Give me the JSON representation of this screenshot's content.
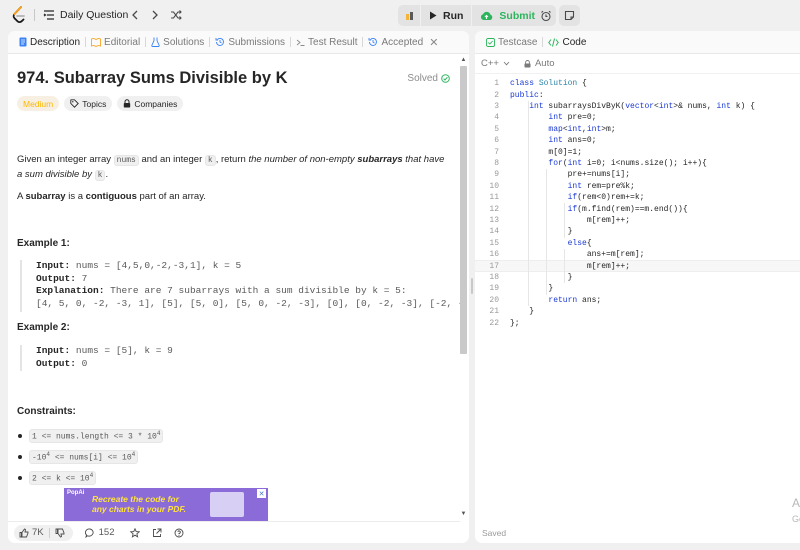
{
  "topbar": {
    "title": "Daily Question",
    "run_label": "Run",
    "submit_label": "Submit"
  },
  "tabs": {
    "description": "Description",
    "editorial": "Editorial",
    "solutions": "Solutions",
    "submissions": "Submissions",
    "test_result": "Test Result",
    "accepted": "Accepted"
  },
  "problem": {
    "title": "974. Subarray Sums Divisible by K",
    "status": "Solved",
    "difficulty": "Medium",
    "topics_label": "Topics",
    "companies_label": "Companies",
    "description": {
      "p1_a": "Given an integer array",
      "p1_code1": "nums",
      "p1_b": "and an integer",
      "p1_code2": "k",
      "p1_c": ", return",
      "p1_d": "the number of non-empty",
      "p1_e": "subarrays",
      "p1_f": "that have a sum divisible by",
      "p1_code3": "k",
      "p1_g": ".",
      "p2_a": "A",
      "p2_b": "subarray",
      "p2_c": "is a",
      "p2_d": "contiguous",
      "p2_e": "part of an array."
    },
    "examples": [
      {
        "title": "Example 1:",
        "input_label": "Input:",
        "input": "nums = [4,5,0,-2,-3,1], k = 5",
        "output_label": "Output:",
        "output": "7",
        "explanation_label": "Explanation:",
        "explanation": "There are 7 subarrays with a sum divisible by k = 5:",
        "explanation_detail": "[4, 5, 0, -2, -3, 1], [5], [5, 0], [5, 0, -2, -3], [0], [0, -2, -3], [-2, -3"
      },
      {
        "title": "Example 2:",
        "input_label": "Input:",
        "input": "nums = [5], k = 9",
        "output_label": "Output:",
        "output": "0"
      }
    ],
    "constraints_title": "Constraints:",
    "constraints": [
      {
        "a": "1 <= nums.length <= 3 * 10",
        "sup": "4",
        "b": ""
      },
      {
        "a": "-10",
        "sup": "4",
        "b": " <= nums[i] <= 10",
        "sup2": "4"
      },
      {
        "a": "2 <= k <= 10",
        "sup": "4",
        "b": ""
      }
    ]
  },
  "ad": {
    "brand": "PopAi",
    "line1": "Recreate the code for",
    "line2": "any charts in your PDF."
  },
  "footer": {
    "likes": "7K",
    "comments": "152"
  },
  "editor": {
    "testcase_tab": "Testcase",
    "code_tab": "Code",
    "language": "C++",
    "mode": "Auto",
    "saved": "Saved",
    "watermark1": "A",
    "watermark2": "Go",
    "highlight_line": 17,
    "lines": [
      "class Solution {",
      "public:",
      "    int subarraysDivByK(vector<int>& nums, int k) {",
      "        int pre=0;",
      "        map<int,int>m;",
      "        int ans=0;",
      "        m[0]=1;",
      "        for(int i=0; i<nums.size(); i++){",
      "            pre+=nums[i];",
      "            int rem=pre%k;",
      "            if(rem<0)rem+=k;",
      "            if(m.find(rem)==m.end()){",
      "                m[rem]++;",
      "            }",
      "            else{",
      "                ans+=m[rem];",
      "                m[rem]++;",
      "            }",
      "        }",
      "        return ans;",
      "    }",
      "};"
    ]
  },
  "colors": {
    "accent_green": "#2db55d",
    "medium": "#ffb800",
    "keyword": "#1a39d6"
  }
}
